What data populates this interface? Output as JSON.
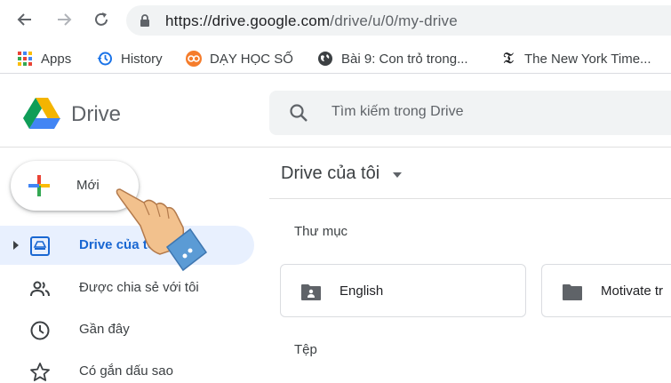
{
  "browser": {
    "url_host": "https://drive.google.com",
    "url_path": "/drive/u/0/my-drive",
    "bookmarks": [
      {
        "label": "Apps",
        "icon": "apps-grid-icon"
      },
      {
        "label": "History",
        "icon": "history-icon"
      },
      {
        "label": "DẠY HỌC SỐ",
        "icon": "dayhocso-icon"
      },
      {
        "label": "Bài 9: Con trỏ trong...",
        "icon": "globe-icon"
      },
      {
        "label": "The New York Time...",
        "icon": "nyt-icon"
      }
    ]
  },
  "drive": {
    "app_name": "Drive",
    "search_placeholder": "Tìm kiếm trong Drive",
    "new_button": "Mới",
    "sidebar": [
      {
        "label": "Drive của tôi",
        "icon": "my-drive-icon",
        "active": true
      },
      {
        "label": "Được chia sẻ với tôi",
        "icon": "shared-with-me-icon",
        "active": false
      },
      {
        "label": "Gần đây",
        "icon": "recent-clock-icon",
        "active": false
      },
      {
        "label": "Có gắn dấu sao",
        "icon": "star-icon",
        "active": false
      }
    ],
    "main_title": "Drive của tôi",
    "folders_section": "Thư mục",
    "files_section": "Tệp",
    "folders": [
      {
        "name": "English"
      },
      {
        "name": "Motivate tr"
      }
    ]
  },
  "colors": {
    "active_bg": "#e8f0fe",
    "active_text": "#1967d2",
    "drive_green": "#0f9d58",
    "drive_yellow": "#f4b400",
    "drive_blue": "#4285f4",
    "hand_skin": "#f2c18d",
    "cuff_blue": "#5b9bd5"
  }
}
